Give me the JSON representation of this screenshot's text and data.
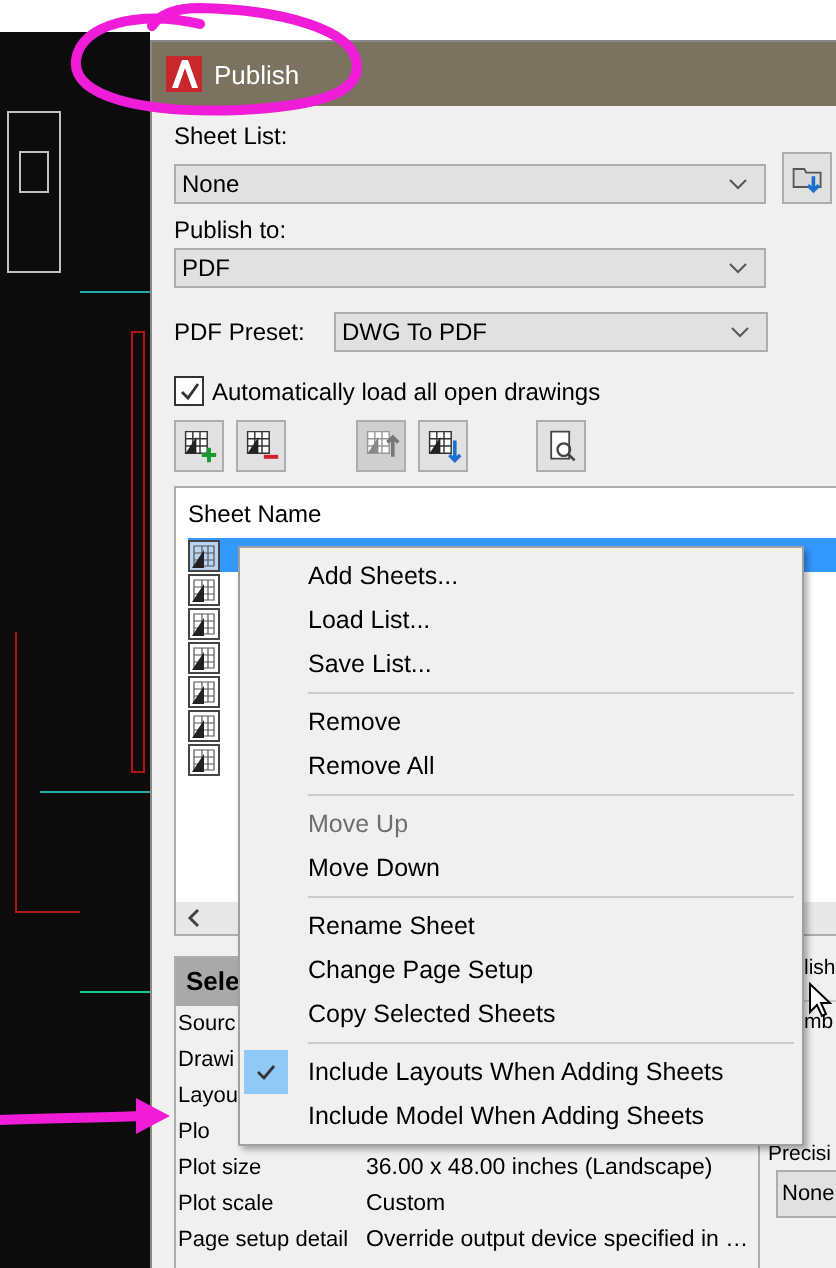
{
  "window": {
    "title": "Publish"
  },
  "sheet_list": {
    "label": "Sheet List:",
    "value": "None"
  },
  "publish_to": {
    "label": "Publish to:",
    "value": "PDF"
  },
  "pdf_preset": {
    "label": "PDF Preset:",
    "value": "DWG To PDF"
  },
  "auto_load": {
    "label": "Automatically load all open drawings",
    "checked": true
  },
  "toolbar": [
    {
      "kind": "add",
      "disabled": false
    },
    {
      "kind": "remove",
      "disabled": false
    },
    {
      "kind": "up",
      "disabled": true
    },
    {
      "kind": "down",
      "disabled": false
    },
    {
      "kind": "preview",
      "disabled": false
    }
  ],
  "sheets": {
    "header": "Sheet Name",
    "rows": [
      {
        "selected": true
      },
      {
        "selected": false
      },
      {
        "selected": false
      },
      {
        "selected": false
      },
      {
        "selected": false
      },
      {
        "selected": false
      },
      {
        "selected": false
      }
    ]
  },
  "context_menu": [
    {
      "kind": "item",
      "label": "Add Sheets...",
      "disabled": false
    },
    {
      "kind": "item",
      "label": "Load List...",
      "disabled": false
    },
    {
      "kind": "item",
      "label": "Save List...",
      "disabled": false
    },
    {
      "kind": "separator"
    },
    {
      "kind": "item",
      "label": "Remove",
      "disabled": false
    },
    {
      "kind": "item",
      "label": "Remove All",
      "disabled": false
    },
    {
      "kind": "separator"
    },
    {
      "kind": "item",
      "label": "Move Up",
      "disabled": true
    },
    {
      "kind": "item",
      "label": "Move Down",
      "disabled": false
    },
    {
      "kind": "separator"
    },
    {
      "kind": "item",
      "label": "Rename Sheet",
      "disabled": false
    },
    {
      "kind": "item",
      "label": "Change Page Setup",
      "disabled": false
    },
    {
      "kind": "item",
      "label": "Copy Selected Sheets",
      "disabled": false
    },
    {
      "kind": "separator"
    },
    {
      "kind": "check",
      "label": "Include Layouts When Adding Sheets",
      "checked": true
    },
    {
      "kind": "check",
      "label": "Include Model When Adding Sheets",
      "checked": false
    }
  ],
  "details": {
    "header": "Sele",
    "rows": [
      {
        "label": "Sourc"
      },
      {
        "label": "Drawi"
      },
      {
        "label": "Layou"
      },
      {
        "label": "Plo"
      },
      {
        "label": "Plot size",
        "value": "36.00 x 48.00 inches (Landscape)"
      },
      {
        "label": "Plot scale",
        "value": "Custom"
      },
      {
        "label": "Page setup detail",
        "value": "Override output device specified in …"
      }
    ]
  },
  "right_panel": {
    "texts": [
      "lish",
      "mb"
    ],
    "precision_label": "Precisi",
    "precision_value": "None"
  }
}
